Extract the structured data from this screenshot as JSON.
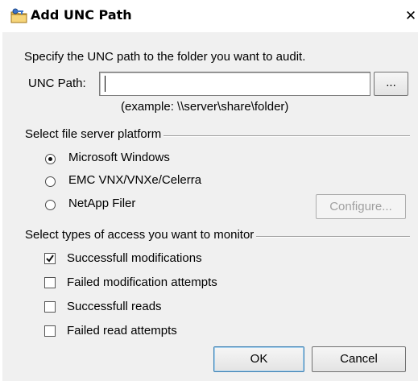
{
  "window": {
    "title": "Add UNC Path",
    "close_glyph": "✕",
    "icon": "folder-key-icon"
  },
  "instructions": "Specify the UNC path to the folder you want to audit.",
  "unc": {
    "label": "UNC Path:",
    "value": "",
    "browse_label": "...",
    "example": "(example: \\\\server\\share\\folder)"
  },
  "platform": {
    "group_label": "Select file server platform",
    "options": [
      {
        "label": "Microsoft Windows",
        "selected": true
      },
      {
        "label": "EMC VNX/VNXe/Celerra",
        "selected": false
      },
      {
        "label": "NetApp Filer",
        "selected": false
      }
    ],
    "configure_label": "Configure..."
  },
  "access": {
    "group_label": "Select types of access you want to monitor",
    "options": [
      {
        "label": "Successfull modifications",
        "checked": true
      },
      {
        "label": "Failed modification attempts",
        "checked": false
      },
      {
        "label": "Successfull reads",
        "checked": false
      },
      {
        "label": "Failed read attempts",
        "checked": false
      }
    ]
  },
  "buttons": {
    "ok": "OK",
    "cancel": "Cancel"
  }
}
